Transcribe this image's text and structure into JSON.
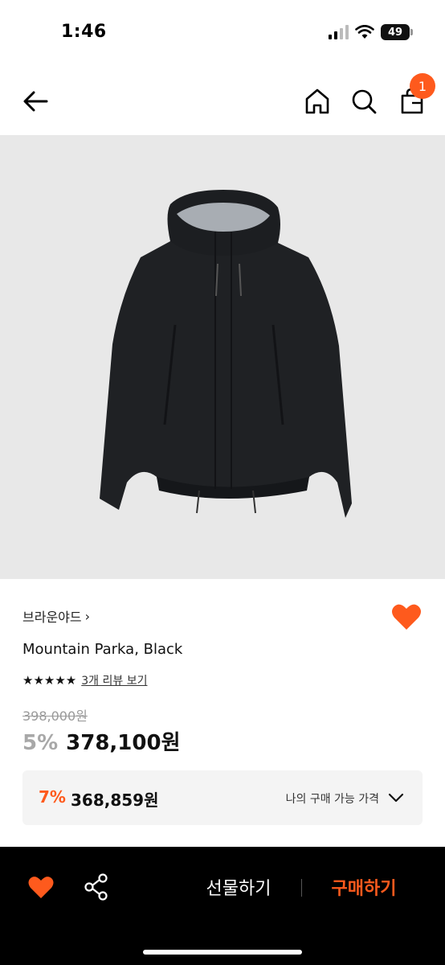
{
  "status_bar": {
    "time": "1:46",
    "battery": "49"
  },
  "nav": {
    "cart_count": "1"
  },
  "product": {
    "brand": "브라운야드",
    "brand_chevron": "›",
    "name": "Mountain Parka, Black",
    "stars": "★★★★★",
    "review_link": "3개 리뷰 보기",
    "original_price": "398,000원",
    "discount": "5%",
    "price": "378,100원"
  },
  "member_price": {
    "discount": "7%",
    "price": "368,859원",
    "label": "나의 구매 가능 가격"
  },
  "bottom_bar": {
    "gift_label": "선물하기",
    "buy_label": "구매하기"
  },
  "colors": {
    "accent": "#fe5a1d",
    "bar_bg": "#000000",
    "image_bg": "#e8e8e8"
  },
  "icons": [
    "back-arrow-icon",
    "home-icon",
    "search-icon",
    "shopping-bag-icon",
    "heart-icon",
    "share-icon",
    "chevron-down-icon"
  ]
}
